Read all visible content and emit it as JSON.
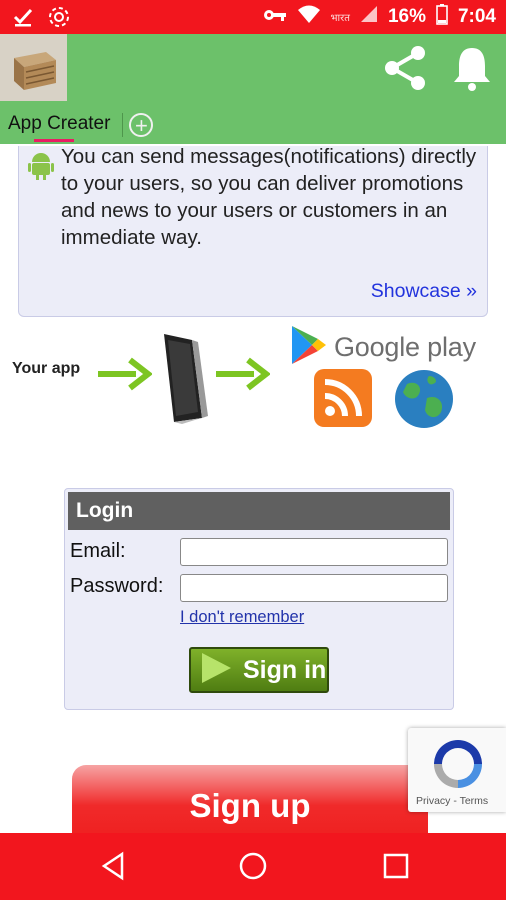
{
  "status_bar": {
    "carrier": "भारत",
    "battery": "16%",
    "time": "7:04",
    "icons": [
      "checkmark-icon",
      "settings-flower-icon",
      "vpn-key-icon",
      "wifi-icon",
      "signal-icon",
      "battery-icon"
    ]
  },
  "app_bar": {
    "tab_label": "App Creater",
    "add_tab_symbol": "+",
    "actions": [
      "share-icon",
      "bell-icon"
    ]
  },
  "info": {
    "message": "You can send messages(notifications) directly to your users, so you can deliver promotions and news to your users or customers in an immediate way.",
    "showcase_link": "Showcase »"
  },
  "flow": {
    "your_app_label": "Your app",
    "store_label": "Google play",
    "icons": [
      "phone-icon",
      "google-play-icon",
      "rss-icon",
      "globe-icon"
    ]
  },
  "login": {
    "title": "Login",
    "email_label": "Email:",
    "password_label": "Password:",
    "email_value": "",
    "password_value": "",
    "forgot_link": "I don't remember",
    "sign_in_label": "Sign in"
  },
  "signup": {
    "label": "Sign up"
  },
  "recaptcha": {
    "links": "Privacy - Terms"
  },
  "colors": {
    "status_bar": "#f2161e",
    "app_bar": "#6cc16a",
    "panel_bg": "#ecedf8",
    "link": "#2233dd",
    "sign_in": "#5f8f1a"
  }
}
